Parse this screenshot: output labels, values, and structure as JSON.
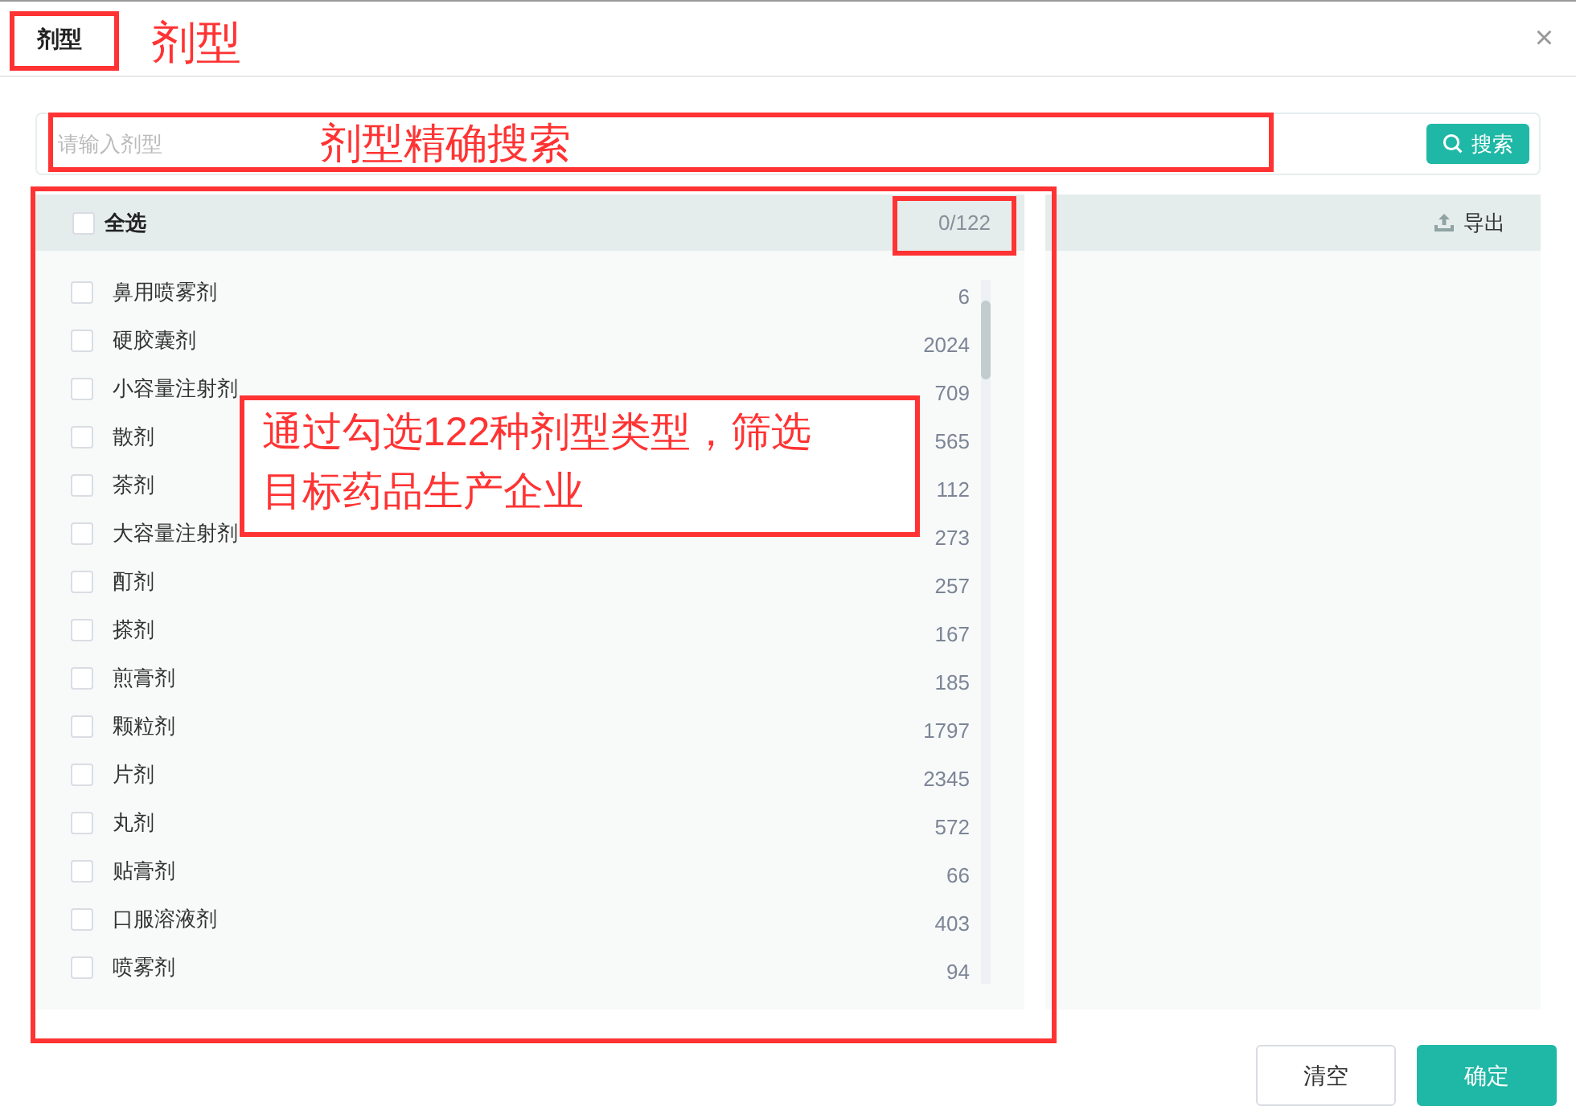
{
  "dialog": {
    "title": "剂型",
    "close": "×"
  },
  "search": {
    "placeholder": "请输入剂型",
    "button": "搜索"
  },
  "list": {
    "select_all": {
      "label": "全选",
      "checked": false
    },
    "counter": "0/122",
    "items": [
      {
        "name": "鼻用喷雾剂",
        "count": "6",
        "checked": false
      },
      {
        "name": "硬胶囊剂",
        "count": "2024",
        "checked": false
      },
      {
        "name": "小容量注射剂",
        "count": "709",
        "checked": false
      },
      {
        "name": "散剂",
        "count": "565",
        "checked": false
      },
      {
        "name": "茶剂",
        "count": "112",
        "checked": false
      },
      {
        "name": "大容量注射剂",
        "count": "273",
        "checked": false
      },
      {
        "name": "酊剂",
        "count": "257",
        "checked": false
      },
      {
        "name": "搽剂",
        "count": "167",
        "checked": false
      },
      {
        "name": "煎膏剂",
        "count": "185",
        "checked": false
      },
      {
        "name": "颗粒剂",
        "count": "1797",
        "checked": false
      },
      {
        "name": "片剂",
        "count": "2345",
        "checked": false
      },
      {
        "name": "丸剂",
        "count": "572",
        "checked": false
      },
      {
        "name": "贴膏剂",
        "count": "66",
        "checked": false
      },
      {
        "name": "口服溶液剂",
        "count": "403",
        "checked": false
      },
      {
        "name": "喷雾剂",
        "count": "94",
        "checked": false
      }
    ]
  },
  "selected_panel": {
    "export": "导出"
  },
  "footer": {
    "buttons": [
      {
        "label": "清空",
        "kind": "secondary"
      },
      {
        "label": "确定",
        "kind": "primary"
      }
    ]
  },
  "annotations": [
    {
      "text": "剂型"
    },
    {
      "text": "剂型精确搜索"
    },
    {
      "lines": [
        "通过勾选122种剂型类型，筛选",
        "目标药品生产企业"
      ]
    }
  ]
}
